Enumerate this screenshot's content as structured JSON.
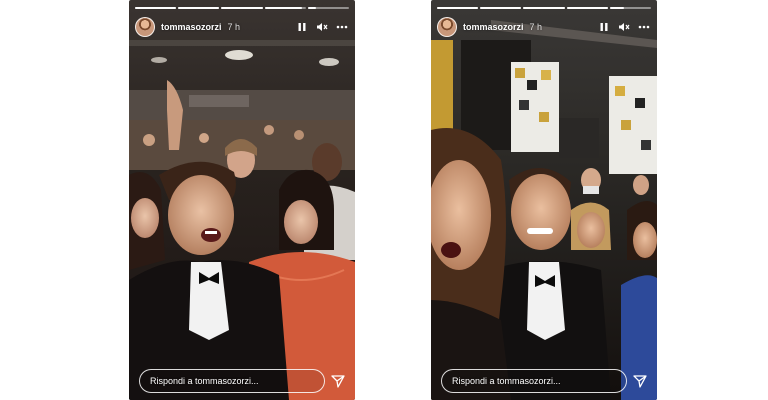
{
  "stories": [
    {
      "username": "tommasozorzi",
      "time_ago": "7 h",
      "reply_placeholder": "Rispondi a tommasozorzi...",
      "progress": [
        1,
        1,
        1,
        0.9,
        0.2
      ],
      "icons": {
        "pause": "pause-icon",
        "mute": "mute-icon",
        "more": "more-icon",
        "send": "send-icon"
      }
    },
    {
      "username": "tommasozorzi",
      "time_ago": "7 h",
      "reply_placeholder": "Rispondi a tommasozorzi...",
      "progress": [
        1,
        1,
        1,
        1,
        0.35
      ],
      "icons": {
        "pause": "pause-icon",
        "mute": "mute-icon",
        "more": "more-icon",
        "send": "send-icon"
      }
    }
  ]
}
